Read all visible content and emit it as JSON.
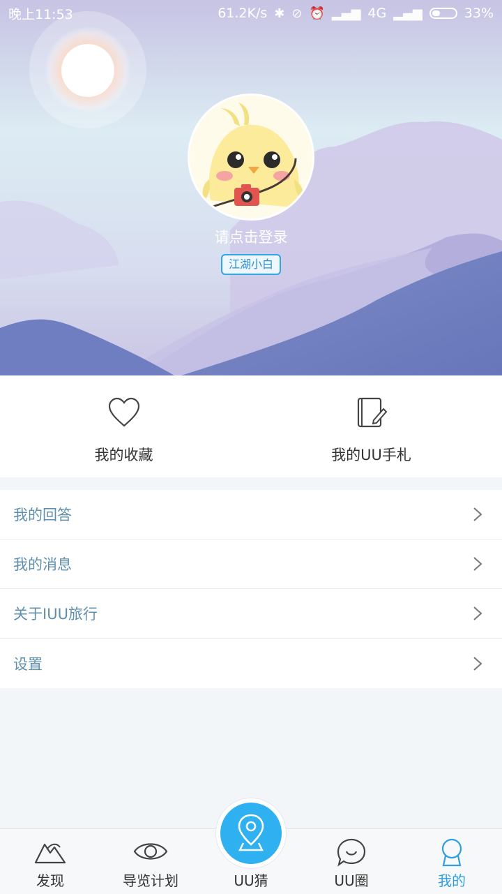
{
  "status_bar": {
    "time": "晚上11:53",
    "speed": "61.2K/s",
    "network": "4G",
    "battery": "33%",
    "battery_level": 0.33
  },
  "profile": {
    "login_prompt": "请点击登录",
    "rank_badge": "江湖小白"
  },
  "quick_actions": [
    {
      "label": "我的收藏",
      "icon": "heart-icon"
    },
    {
      "label": "我的UU手札",
      "icon": "notebook-icon"
    }
  ],
  "menu": [
    {
      "label": "我的回答"
    },
    {
      "label": "我的消息"
    },
    {
      "label": "关于IUU旅行"
    },
    {
      "label": "设置"
    }
  ],
  "tabs": [
    {
      "label": "发现",
      "icon": "mountain-icon"
    },
    {
      "label": "导览计划",
      "icon": "eye-icon"
    },
    {
      "label": "UU猜",
      "icon": "location-pin-icon"
    },
    {
      "label": "UU圈",
      "icon": "chat-bubble-icon"
    },
    {
      "label": "我的",
      "icon": "person-icon",
      "active": true
    }
  ],
  "colors": {
    "accent": "#2fb0f0",
    "menu_text": "#5f8fae",
    "active_tab": "#2f9fe0"
  }
}
